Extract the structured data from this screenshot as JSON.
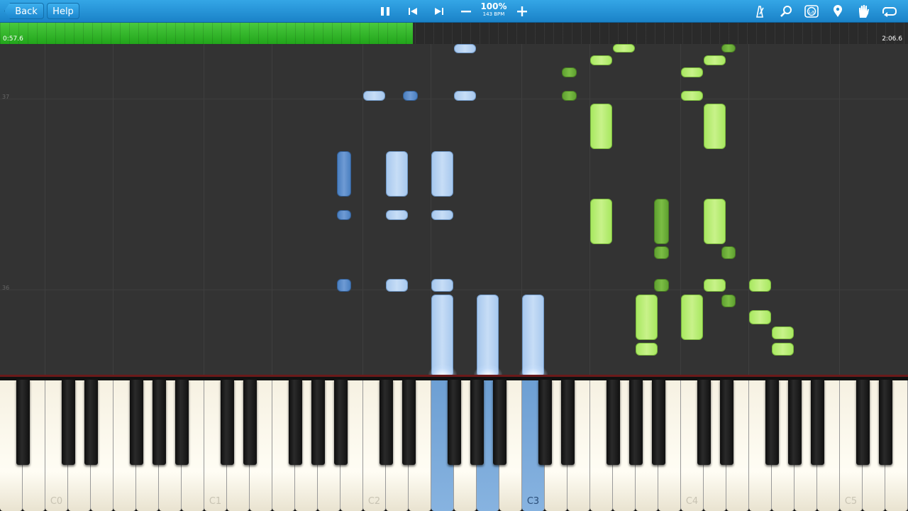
{
  "toolbar": {
    "back_label": "Back",
    "help_label": "Help",
    "zoom_level": "100%",
    "tempo": "143 BPM",
    "bar_color": "#2092d8"
  },
  "progress": {
    "elapsed": "0:57.6",
    "total": "2:06.6",
    "fraction": 0.455,
    "fill_color": "#2fb527"
  },
  "roll": {
    "measure_numbers": [
      "37",
      "36"
    ]
  },
  "keyboard": {
    "octave_labels": [
      "C0",
      "C1",
      "C2",
      "C3",
      "C4",
      "C5"
    ]
  },
  "colors": {
    "left_hand_light": "#a7c8ee",
    "left_hand_dark": "#4a7fc0",
    "right_hand_light": "#a8e860",
    "right_hand_dark": "#5fa030"
  }
}
